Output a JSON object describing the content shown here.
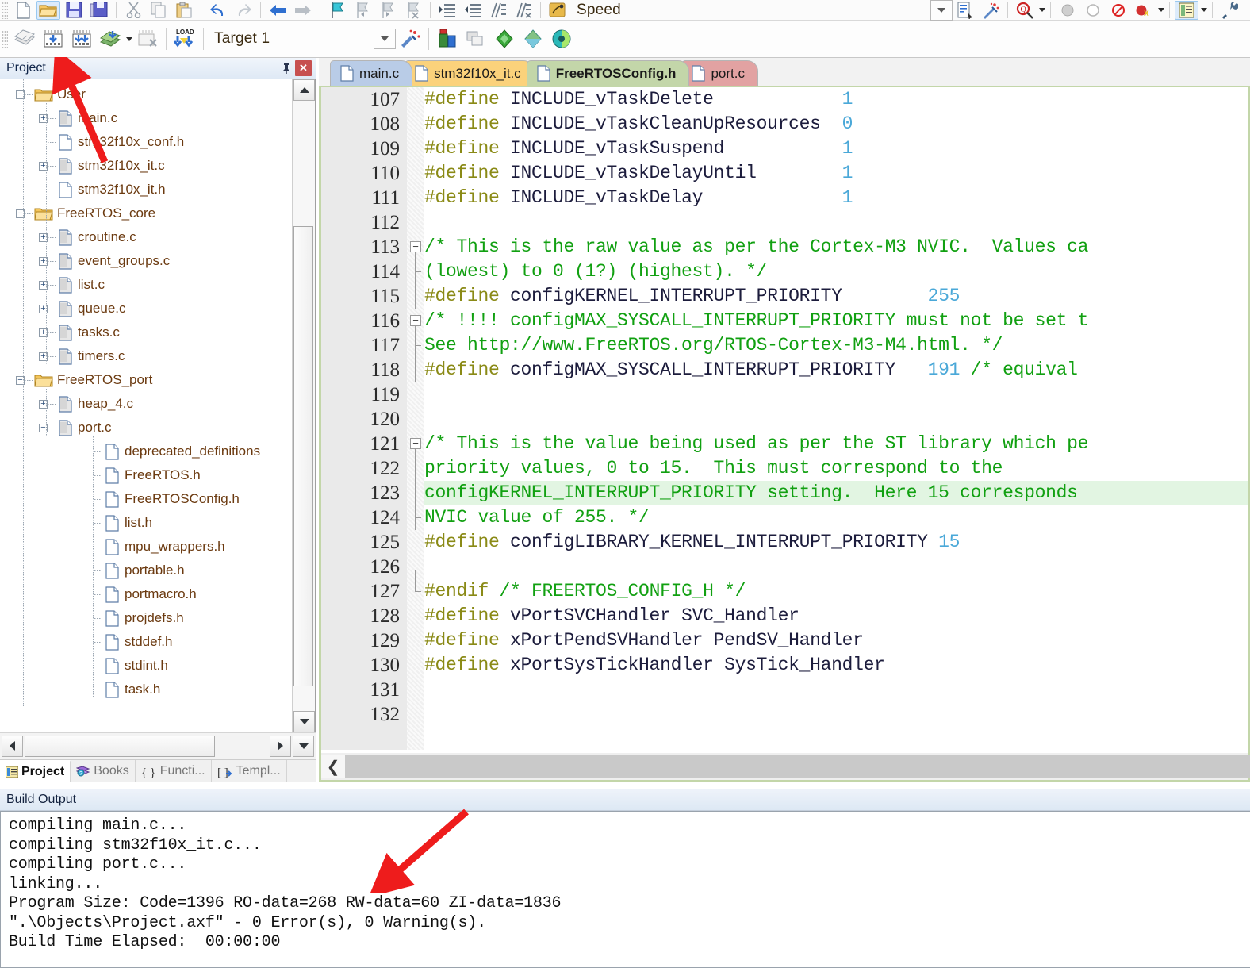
{
  "toolbars": {
    "row1_icons": [
      "new-file-icon",
      "open-folder-icon",
      "save-icon",
      "save-all-icon",
      "cut-icon",
      "copy-icon",
      "paste-icon",
      "undo-icon",
      "redo-icon",
      "navigate-back-icon",
      "navigate-forward-icon",
      "bookmark-toggle-icon",
      "bookmark-prev-icon",
      "bookmark-next-icon",
      "bookmark-clear-icon",
      "indent-icon",
      "outdent-icon",
      "comment-icon",
      "uncomment-icon",
      "speed-icon"
    ],
    "speed_label": "Speed",
    "row1_right_icons": [
      "combo-dropdown-icon",
      "debug-settings-icon",
      "magic-wand-icon",
      "find-in-files-icon",
      "insert-breakpoint-icon",
      "kill-breakpoint-icon",
      "disable-breakpoint-icon",
      "kill-all-breakpoints-icon",
      "manage-windows-icon",
      "configure-icon"
    ],
    "row2_icons": [
      "translate-icon",
      "build-icon",
      "rebuild-icon",
      "batch-build-icon",
      "batch-build-dropdown-icon",
      "stop-build-icon",
      "load-icon"
    ],
    "target_label": "Target 1",
    "row2_right_icons": [
      "target-options-icon",
      "manage-run-time-env-icon",
      "pack-installer-icon",
      "multi-project-icon",
      "component-green-icon",
      "component-blue-icon",
      "component-teal-icon"
    ]
  },
  "project_panel": {
    "title": "Project",
    "pin_icon": "pin-icon",
    "close_icon": "close-icon",
    "tree": [
      {
        "label": "User",
        "type": "folder",
        "depth": 0,
        "toggle": "minus"
      },
      {
        "label": "main.c",
        "type": "file",
        "depth": 1,
        "toggle": "plus"
      },
      {
        "label": "stm32f10x_conf.h",
        "type": "header",
        "depth": 1,
        "toggle": "none"
      },
      {
        "label": "stm32f10x_it.c",
        "type": "file",
        "depth": 1,
        "toggle": "plus"
      },
      {
        "label": "stm32f10x_it.h",
        "type": "header",
        "depth": 1,
        "toggle": "none"
      },
      {
        "label": "FreeRTOS_core",
        "type": "folder",
        "depth": 0,
        "toggle": "minus"
      },
      {
        "label": "croutine.c",
        "type": "file",
        "depth": 1,
        "toggle": "plus"
      },
      {
        "label": "event_groups.c",
        "type": "file",
        "depth": 1,
        "toggle": "plus"
      },
      {
        "label": "list.c",
        "type": "file",
        "depth": 1,
        "toggle": "plus"
      },
      {
        "label": "queue.c",
        "type": "file",
        "depth": 1,
        "toggle": "plus"
      },
      {
        "label": "tasks.c",
        "type": "file",
        "depth": 1,
        "toggle": "plus"
      },
      {
        "label": "timers.c",
        "type": "file",
        "depth": 1,
        "toggle": "plus"
      },
      {
        "label": "FreeRTOS_port",
        "type": "folder",
        "depth": 0,
        "toggle": "minus"
      },
      {
        "label": "heap_4.c",
        "type": "file",
        "depth": 1,
        "toggle": "plus"
      },
      {
        "label": "port.c",
        "type": "file",
        "depth": 1,
        "toggle": "minus"
      },
      {
        "label": "deprecated_definitions",
        "type": "header",
        "depth": 2,
        "toggle": "none"
      },
      {
        "label": "FreeRTOS.h",
        "type": "header",
        "depth": 2,
        "toggle": "none"
      },
      {
        "label": "FreeRTOSConfig.h",
        "type": "header",
        "depth": 2,
        "toggle": "none"
      },
      {
        "label": "list.h",
        "type": "header",
        "depth": 2,
        "toggle": "none"
      },
      {
        "label": "mpu_wrappers.h",
        "type": "header",
        "depth": 2,
        "toggle": "none"
      },
      {
        "label": "portable.h",
        "type": "header",
        "depth": 2,
        "toggle": "none"
      },
      {
        "label": "portmacro.h",
        "type": "header",
        "depth": 2,
        "toggle": "none"
      },
      {
        "label": "projdefs.h",
        "type": "header",
        "depth": 2,
        "toggle": "none"
      },
      {
        "label": "stddef.h",
        "type": "header",
        "depth": 2,
        "toggle": "none"
      },
      {
        "label": "stdint.h",
        "type": "header",
        "depth": 2,
        "toggle": "none"
      },
      {
        "label": "task.h",
        "type": "header",
        "depth": 2,
        "toggle": "none"
      }
    ],
    "bottom_tabs": [
      {
        "label": "Project",
        "icon": "project-icon",
        "selected": true
      },
      {
        "label": "Books",
        "icon": "books-icon",
        "selected": false
      },
      {
        "label": "Functi...",
        "icon": "functions-icon",
        "selected": false
      },
      {
        "label": "Templ...",
        "icon": "templates-icon",
        "selected": false
      }
    ]
  },
  "editor": {
    "tabs": [
      {
        "label": "main.c",
        "color": "#b9cce7",
        "selected": false,
        "underline": false
      },
      {
        "label": "stm32f10x_it.c",
        "color": "#fbd27b",
        "selected": false,
        "underline": false
      },
      {
        "label": "FreeRTOSConfig.h",
        "color": "#c3d6a9",
        "selected": true,
        "underline": true
      },
      {
        "label": "port.c",
        "color": "#e2a2a2",
        "selected": false,
        "underline": false
      }
    ],
    "first_line": 107,
    "highlight_line": 123,
    "lines": [
      {
        "n": 107,
        "fold": "",
        "tokens": [
          {
            "t": "#define ",
            "c": "def"
          },
          {
            "t": "INCLUDE_vTaskDelete            ",
            "c": "id"
          },
          {
            "t": "1",
            "c": "num"
          }
        ]
      },
      {
        "n": 108,
        "fold": "",
        "tokens": [
          {
            "t": "#define ",
            "c": "def"
          },
          {
            "t": "INCLUDE_vTaskCleanUpResources  ",
            "c": "id"
          },
          {
            "t": "0",
            "c": "num"
          }
        ]
      },
      {
        "n": 109,
        "fold": "",
        "tokens": [
          {
            "t": "#define ",
            "c": "def"
          },
          {
            "t": "INCLUDE_vTaskSuspend           ",
            "c": "id"
          },
          {
            "t": "1",
            "c": "num"
          }
        ]
      },
      {
        "n": 110,
        "fold": "",
        "tokens": [
          {
            "t": "#define ",
            "c": "def"
          },
          {
            "t": "INCLUDE_vTaskDelayUntil        ",
            "c": "id"
          },
          {
            "t": "1",
            "c": "num"
          }
        ]
      },
      {
        "n": 111,
        "fold": "",
        "tokens": [
          {
            "t": "#define ",
            "c": "def"
          },
          {
            "t": "INCLUDE_vTaskDelay             ",
            "c": "id"
          },
          {
            "t": "1",
            "c": "num"
          }
        ]
      },
      {
        "n": 112,
        "fold": "",
        "tokens": []
      },
      {
        "n": 113,
        "fold": "box",
        "tokens": [
          {
            "t": "/* This is the raw value as per the Cortex-M3 NVIC.  Values ca",
            "c": "cmt"
          }
        ]
      },
      {
        "n": 114,
        "fold": "tick",
        "tokens": [
          {
            "t": "(lowest) to 0 (1?) (highest). */",
            "c": "cmt"
          }
        ]
      },
      {
        "n": 115,
        "fold": "stem",
        "tokens": [
          {
            "t": "#define ",
            "c": "def"
          },
          {
            "t": "configKERNEL_INTERRUPT_PRIORITY        ",
            "c": "id"
          },
          {
            "t": "255",
            "c": "num"
          }
        ]
      },
      {
        "n": 116,
        "fold": "box",
        "tokens": [
          {
            "t": "/* !!!! configMAX_SYSCALL_INTERRUPT_PRIORITY must not be set t",
            "c": "cmt"
          }
        ]
      },
      {
        "n": 117,
        "fold": "tick",
        "tokens": [
          {
            "t": "See http://www.FreeRTOS.org/RTOS-Cortex-M3-M4.html. */",
            "c": "cmt"
          }
        ]
      },
      {
        "n": 118,
        "fold": "stem",
        "tokens": [
          {
            "t": "#define ",
            "c": "def"
          },
          {
            "t": "configMAX_SYSCALL_INTERRUPT_PRIORITY   ",
            "c": "id"
          },
          {
            "t": "191",
            "c": "num"
          },
          {
            "t": " /* equival",
            "c": "cmt"
          }
        ]
      },
      {
        "n": 119,
        "fold": "",
        "tokens": []
      },
      {
        "n": 120,
        "fold": "",
        "tokens": []
      },
      {
        "n": 121,
        "fold": "box",
        "tokens": [
          {
            "t": "/* This is the value being used as per the ST library which pe",
            "c": "cmt"
          }
        ]
      },
      {
        "n": 122,
        "fold": "stem",
        "tokens": [
          {
            "t": "priority values, 0 to 15.  This must correspond to the",
            "c": "cmt"
          }
        ]
      },
      {
        "n": 123,
        "fold": "stem",
        "tokens": [
          {
            "t": "configKERNEL_INTERRUPT_PRIORITY setting.  Here 15 corresponds ",
            "c": "cmt"
          }
        ]
      },
      {
        "n": 124,
        "fold": "tick",
        "tokens": [
          {
            "t": "NVIC value of 255. */",
            "c": "cmt"
          }
        ]
      },
      {
        "n": 125,
        "fold": "",
        "tokens": [
          {
            "t": "#define ",
            "c": "def"
          },
          {
            "t": "configLIBRARY_KERNEL_INTERRUPT_PRIORITY ",
            "c": "id"
          },
          {
            "t": "15",
            "c": "num"
          }
        ]
      },
      {
        "n": 126,
        "fold": "",
        "tokens": []
      },
      {
        "n": 127,
        "fold": "end",
        "tokens": [
          {
            "t": "#endif ",
            "c": "def"
          },
          {
            "t": "/* FREERTOS_CONFIG_H */",
            "c": "cmt"
          }
        ]
      },
      {
        "n": 128,
        "fold": "",
        "tokens": [
          {
            "t": "#define ",
            "c": "def"
          },
          {
            "t": "vPortSVCHandler SVC_Handler",
            "c": "id"
          }
        ]
      },
      {
        "n": 129,
        "fold": "",
        "tokens": [
          {
            "t": "#define ",
            "c": "def"
          },
          {
            "t": "xPortPendSVHandler PendSV_Handler",
            "c": "id"
          }
        ]
      },
      {
        "n": 130,
        "fold": "",
        "tokens": [
          {
            "t": "#define ",
            "c": "def"
          },
          {
            "t": "xPortSysTickHandler SysTick_Handler",
            "c": "id"
          }
        ]
      },
      {
        "n": 131,
        "fold": "",
        "tokens": []
      },
      {
        "n": 132,
        "fold": "",
        "tokens": []
      }
    ]
  },
  "build_output": {
    "title": "Build Output",
    "lines": [
      "compiling main.c...",
      "compiling stm32f10x_it.c...",
      "compiling port.c...",
      "linking...",
      "Program Size: Code=1396 RO-data=268 RW-data=60 ZI-data=1836",
      "\".\\Objects\\Project.axf\" - 0 Error(s), 0 Warning(s).",
      "Build Time Elapsed:  00:00:00"
    ]
  },
  "colors": {
    "comment": "#11a011",
    "preprocessor": "#8a8a16",
    "number": "#4aa8d8",
    "identifier": "#1c1c3c",
    "current_line_highlight": "#e2f5e2",
    "annotation_arrow": "#ee1c1c"
  }
}
